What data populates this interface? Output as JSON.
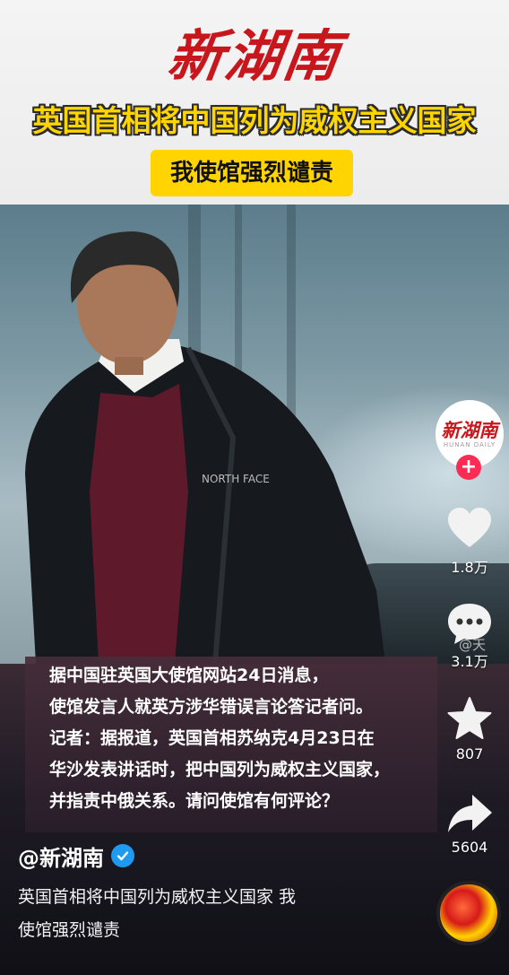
{
  "header": {
    "logo": "新湖南",
    "headline": "英国首相将中国列为威权主义国家",
    "subhead": "我使馆强烈谴责"
  },
  "panel": {
    "lines": [
      "据中国驻英国大使馆网站24日消息，",
      "使馆发言人就英方涉华错误言论答记者问。",
      "记者：据报道，英国首相苏纳克4月23日在",
      "华沙发表讲话时，把中国列为威权主义国家，",
      "并指责中俄关系。请问使馆有何评论？"
    ]
  },
  "author": {
    "name": "@新湖南"
  },
  "caption": {
    "line1": "英国首相将中国列为威权主义国家 我",
    "line2": "使馆强烈谴责"
  },
  "rail": {
    "avatar_text": "新湖南",
    "avatar_sub": "HUNAN DAILY",
    "follow": "+",
    "likes": "1.8万",
    "comments": "3.1万",
    "favorites": "807",
    "shares": "5604"
  },
  "watermark": "@天",
  "colors": {
    "brand_red": "#c8161d",
    "headline_yellow": "#ffd500",
    "follow_pink": "#fe2c55",
    "verified_blue": "#1e9bf0"
  }
}
